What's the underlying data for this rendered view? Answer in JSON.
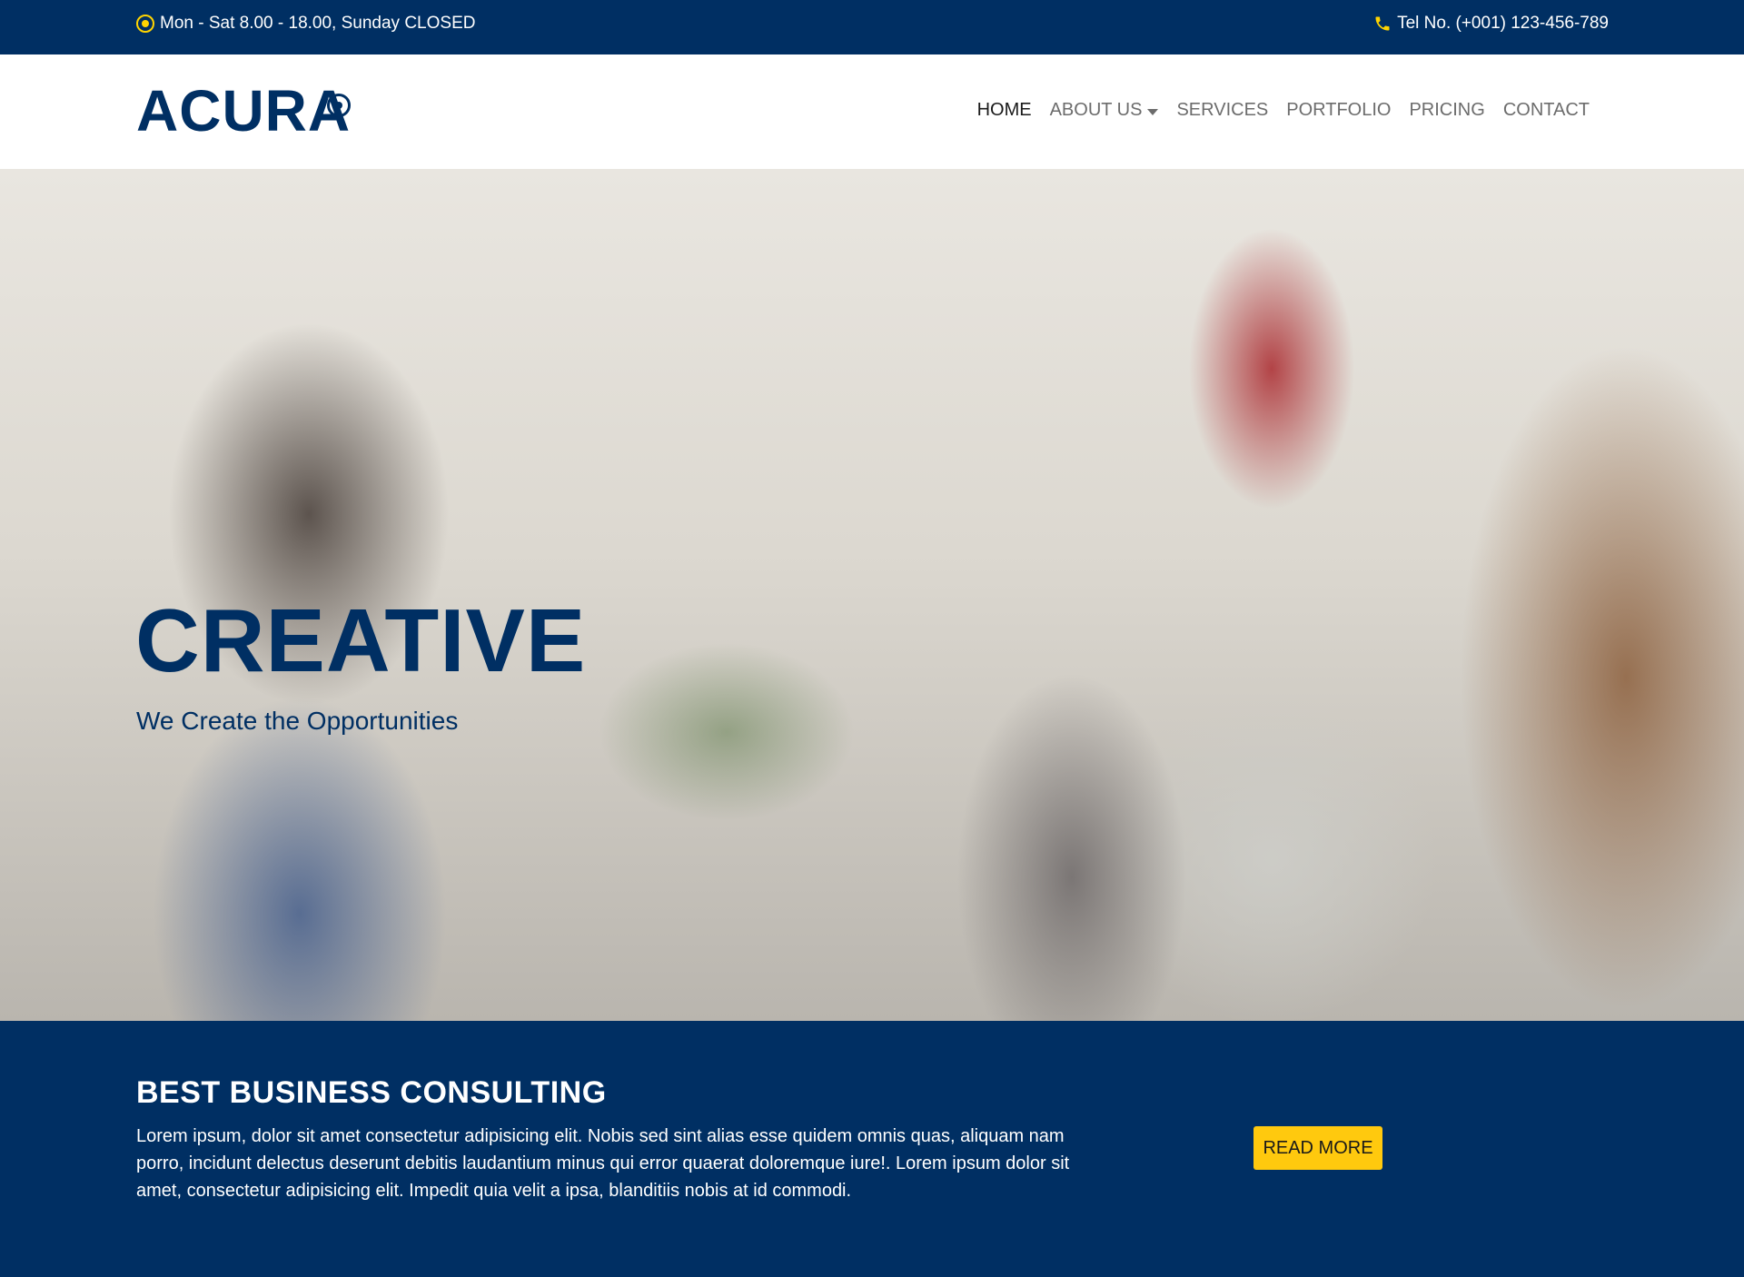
{
  "topbar": {
    "hours": "Mon - Sat 8.00 - 18.00, Sunday CLOSED",
    "phone": "Tel No. (+001) 123-456-789",
    "icons": {
      "hours": "clock-icon",
      "phone": "phone-icon"
    },
    "colors": {
      "background": "#002f63",
      "icon": "#ffd400"
    }
  },
  "header": {
    "logo": "ACURA",
    "nav": [
      {
        "label": "HOME",
        "active": true
      },
      {
        "label": "ABOUT US",
        "has_dropdown": true
      },
      {
        "label": "SERVICES"
      },
      {
        "label": "PORTFOLIO"
      },
      {
        "label": "PRICING"
      },
      {
        "label": "CONTACT"
      }
    ]
  },
  "hero": {
    "title": "CREATIVE",
    "subtitle": "We Create the Opportunities"
  },
  "band": {
    "heading": "BEST BUSINESS CONSULTING",
    "text": "Lorem ipsum, dolor sit amet consectetur adipisicing elit. Nobis sed sint alias esse quidem omnis quas, aliquam nam porro, incidunt delectus deserunt debitis laudantium minus qui error quaerat doloremque iure!. Lorem ipsum dolor sit amet, consectetur adipisicing elit. Impedit quia velit a ipsa, blanditiis nobis at id commodi.",
    "button": "READ MORE",
    "colors": {
      "background": "#002f63",
      "button": "#ffc90e"
    }
  }
}
